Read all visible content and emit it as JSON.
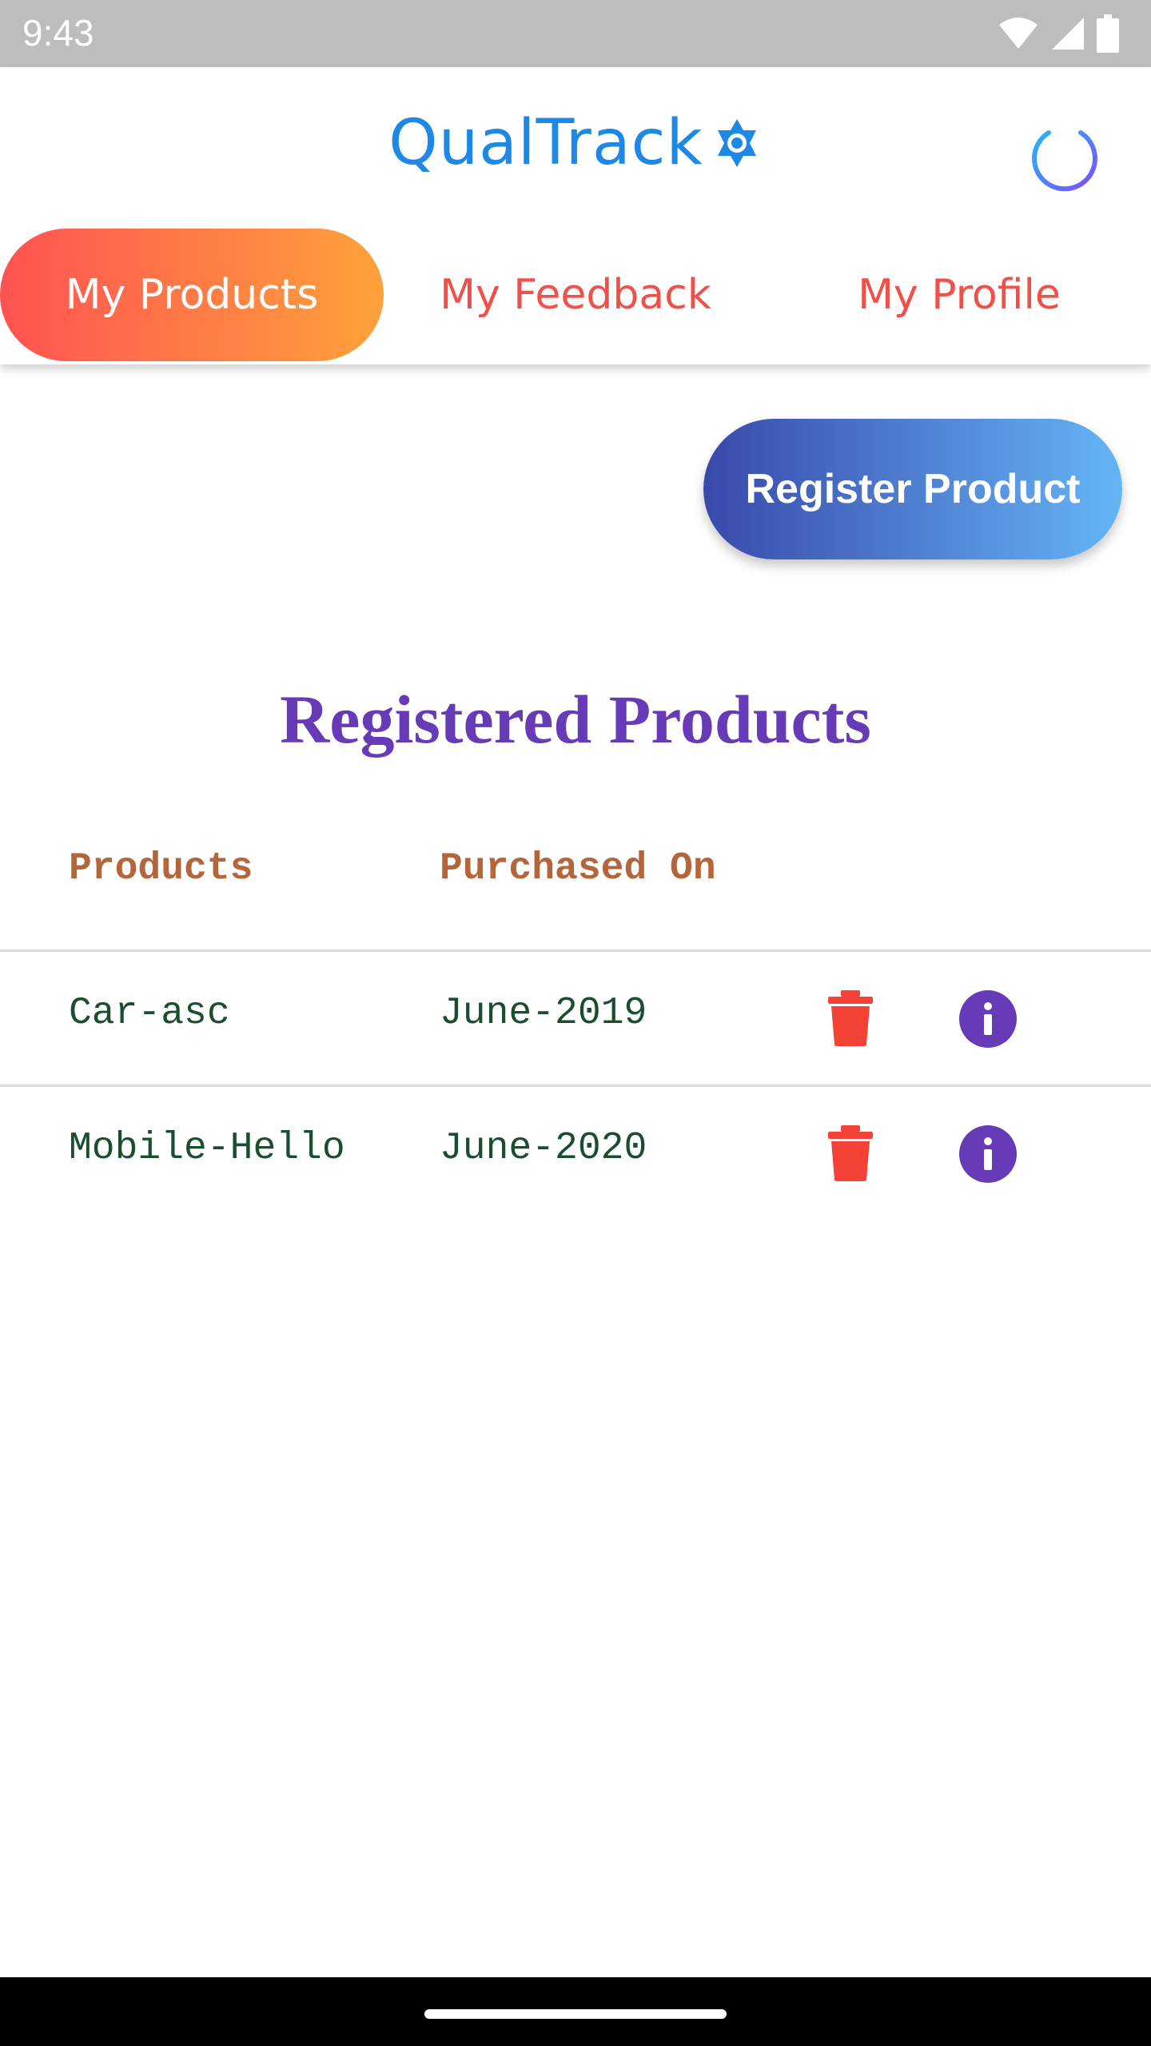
{
  "status_bar": {
    "time": "9:43"
  },
  "header": {
    "app_title": "QualTrack",
    "tabs": [
      {
        "label": "My Products",
        "active": true
      },
      {
        "label": "My Feedback",
        "active": false
      },
      {
        "label": "My Profile",
        "active": false
      }
    ]
  },
  "actions": {
    "register_label": "Register Product"
  },
  "section": {
    "title": "Registered Products"
  },
  "table": {
    "columns": [
      "Products",
      "Purchased On"
    ],
    "rows": [
      {
        "product": "Car-asc",
        "purchased_on": "June-2019"
      },
      {
        "product": "Mobile-Hello",
        "purchased_on": "June-2020"
      }
    ]
  },
  "icons": {
    "logo": "gear-star-icon",
    "power": "power-icon",
    "delete": "trash-icon",
    "info": "info-icon"
  },
  "colors": {
    "brand": "#1e88e5",
    "tab_gradient": [
      "#ff5252",
      "#ffa23a"
    ],
    "tab_text": "#f0504a",
    "register_gradient": [
      "#3949ab",
      "#64b5f6"
    ],
    "title": "#673ab7",
    "header_text": "#b5653a",
    "cell_text": "#1b4d2f",
    "delete": "#f44336",
    "info": "#673ab7"
  }
}
